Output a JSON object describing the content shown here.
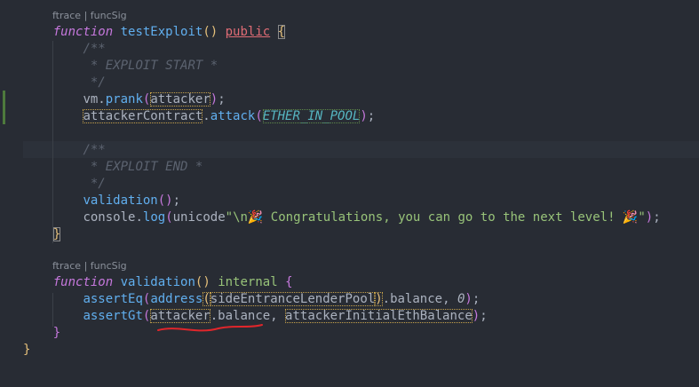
{
  "lens": {
    "top": "ftrace | funcSig",
    "bottom": "ftrace | funcSig"
  },
  "code": {
    "l1": {
      "kw": "function",
      "name": "testExploit",
      "parens": "()",
      "vis": "public",
      "brace": "{"
    },
    "l2": "/**",
    "l3": " * EXPLOIT START *",
    "l4": " */",
    "l5": {
      "obj": "vm",
      "dot": ".",
      "method": "prank",
      "open": "(",
      "arg": "attacker",
      "close": ")",
      "end": ";"
    },
    "l6": {
      "obj": "attackerContract",
      "dot": ".",
      "method": "attack",
      "open": "(",
      "arg": "ETHER_IN_POOL",
      "close": ")",
      "end": ";"
    },
    "l7": "/**",
    "l8": " * EXPLOIT END *",
    "l9": " */",
    "l10": {
      "method": "validation",
      "parens": "()",
      "end": ";"
    },
    "l11": {
      "obj": "console",
      "dot": ".",
      "method": "log",
      "open": "(",
      "prefix": "unicode",
      "str": "\"\\n🎉 Congratulations, you can go to the next level! 🎉\"",
      "close": ")",
      "end": ";"
    },
    "l12": "}",
    "l13": {
      "kw": "function",
      "name": "validation",
      "parens": "()",
      "vis": "internal",
      "brace": "{"
    },
    "l14": {
      "method": "assertEq",
      "open": "(",
      "cast": "address",
      "castOpen": "(",
      "arg": "sideEntranceLenderPool",
      "castClose": ")",
      "prop": ".balance, ",
      "num": "0",
      "close": ")",
      "end": ";"
    },
    "l15": {
      "method": "assertGt",
      "open": "(",
      "arg1": "attacker",
      "prop": ".balance, ",
      "arg2": "attackerInitialEthBalance",
      "close": ")",
      "end": ";"
    },
    "l16": "}",
    "l17": "}"
  }
}
